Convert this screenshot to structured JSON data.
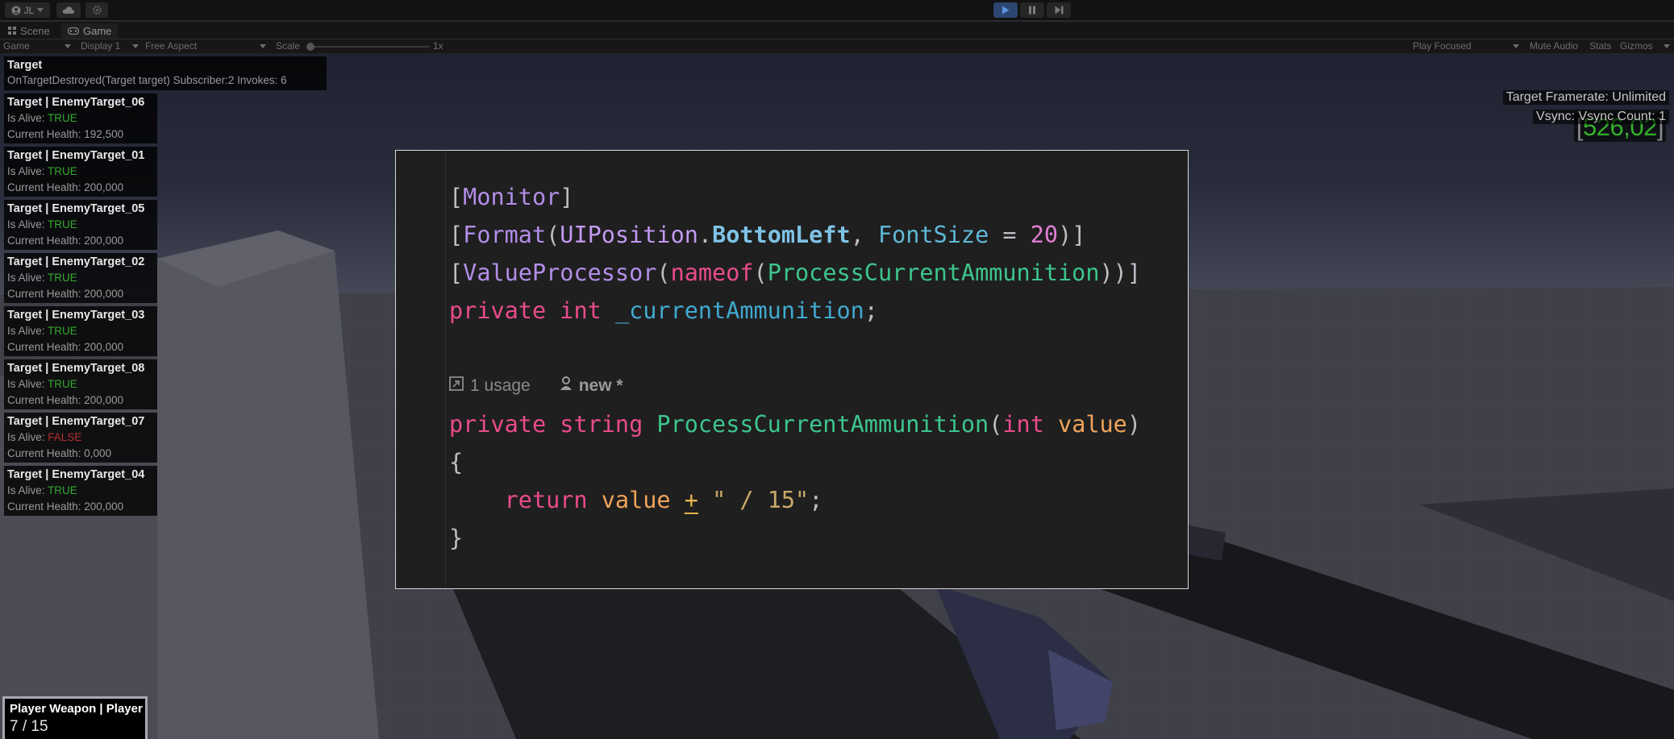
{
  "toolbar": {
    "account_label": "JL",
    "account_icon": "user-circle-icon",
    "cloud_icon": "cloud-icon",
    "settings_icon": "gear-icon",
    "play_icon": "play-icon",
    "pause_icon": "pause-icon",
    "step_icon": "step-forward-icon",
    "accent_color": "#3d6fb0"
  },
  "tabs": [
    {
      "label": "Scene",
      "icon": "grid-icon"
    },
    {
      "label": "Game",
      "icon": "gamepad-icon"
    }
  ],
  "game_bar": {
    "mode": "Game",
    "display": "Display 1",
    "aspect": "Free Aspect",
    "scale_label": "Scale",
    "scale_value": "1x",
    "play_focused": "Play Focused",
    "mute_audio": "Mute Audio",
    "stats": "Stats",
    "gizmos": "Gizmos"
  },
  "monitor": {
    "header": {
      "title": "Target",
      "event": "OnTargetDestroyed(Target target) Subscriber:2 Invokes: 6"
    },
    "targets": [
      {
        "title": "Target | EnemyTarget_06",
        "alive_label": "Is Alive: ",
        "alive": "TRUE",
        "health": "Current Health: 192,500"
      },
      {
        "title": "Target | EnemyTarget_01",
        "alive_label": "Is Alive: ",
        "alive": "TRUE",
        "health": "Current Health: 200,000"
      },
      {
        "title": "Target | EnemyTarget_05",
        "alive_label": "Is Alive: ",
        "alive": "TRUE",
        "health": "Current Health: 200,000"
      },
      {
        "title": "Target | EnemyTarget_02",
        "alive_label": "Is Alive: ",
        "alive": "TRUE",
        "health": "Current Health: 200,000"
      },
      {
        "title": "Target | EnemyTarget_03",
        "alive_label": "Is Alive: ",
        "alive": "TRUE",
        "health": "Current Health: 200,000"
      },
      {
        "title": "Target | EnemyTarget_08",
        "alive_label": "Is Alive: ",
        "alive": "TRUE",
        "health": "Current Health: 200,000"
      },
      {
        "title": "Target | EnemyTarget_07",
        "alive_label": "Is Alive: ",
        "alive": "FALSE",
        "health": "Current Health: 0,000"
      },
      {
        "title": "Target | EnemyTarget_04",
        "alive_label": "Is Alive: ",
        "alive": "TRUE",
        "health": "Current Health: 200,000"
      }
    ],
    "fps": {
      "open": "[",
      "value": "526,02",
      "close": "]",
      "framerate": "Target Framerate: Unlimited",
      "vsync": "Vsync: Vsync Count: 1"
    },
    "weapon": {
      "title": "Player Weapon | Player",
      "ammo": "7 / 15"
    }
  },
  "code": {
    "line1": {
      "open": "[",
      "attr": "Monitor",
      "close": "]"
    },
    "line2": {
      "open": "[",
      "attr": "Format",
      "p1": "(",
      "cls": "UIPosition",
      "dot": ".",
      "member": "BottomLeft",
      "comma": ", ",
      "param": "FontSize",
      "eq": " = ",
      "num": "20",
      "p2": ")]"
    },
    "line3": {
      "open": "[",
      "attr": "ValueProcessor",
      "p1": "(",
      "kw": "nameof",
      "p2": "(",
      "meth": "ProcessCurrentAmmunition",
      "p3": "))]"
    },
    "line4": {
      "kw1": "private",
      "sp1": " ",
      "kw2": "int",
      "sp2": " ",
      "field": "_currentAmmunition",
      "semi": ";"
    },
    "lens": {
      "usage_icon": "usage-arrow-icon",
      "usage": "1 usage",
      "author_icon": "person-icon",
      "author": "new *"
    },
    "line5": {
      "kw1": "private",
      "sp1": " ",
      "kw2": "string",
      "sp2": " ",
      "meth": "ProcessCurrentAmmunition",
      "p1": "(",
      "kw3": "int",
      "sp3": " ",
      "param": "value",
      "p2": ")"
    },
    "line6": {
      "brace": "{"
    },
    "line7": {
      "indent": "    ",
      "kw": "return",
      "sp1": " ",
      "local": "value",
      "sp2": " ",
      "op": "+",
      "sp3": " ",
      "str": "\" / 15\"",
      "semi": ";"
    },
    "line8": {
      "brace": "}"
    }
  }
}
